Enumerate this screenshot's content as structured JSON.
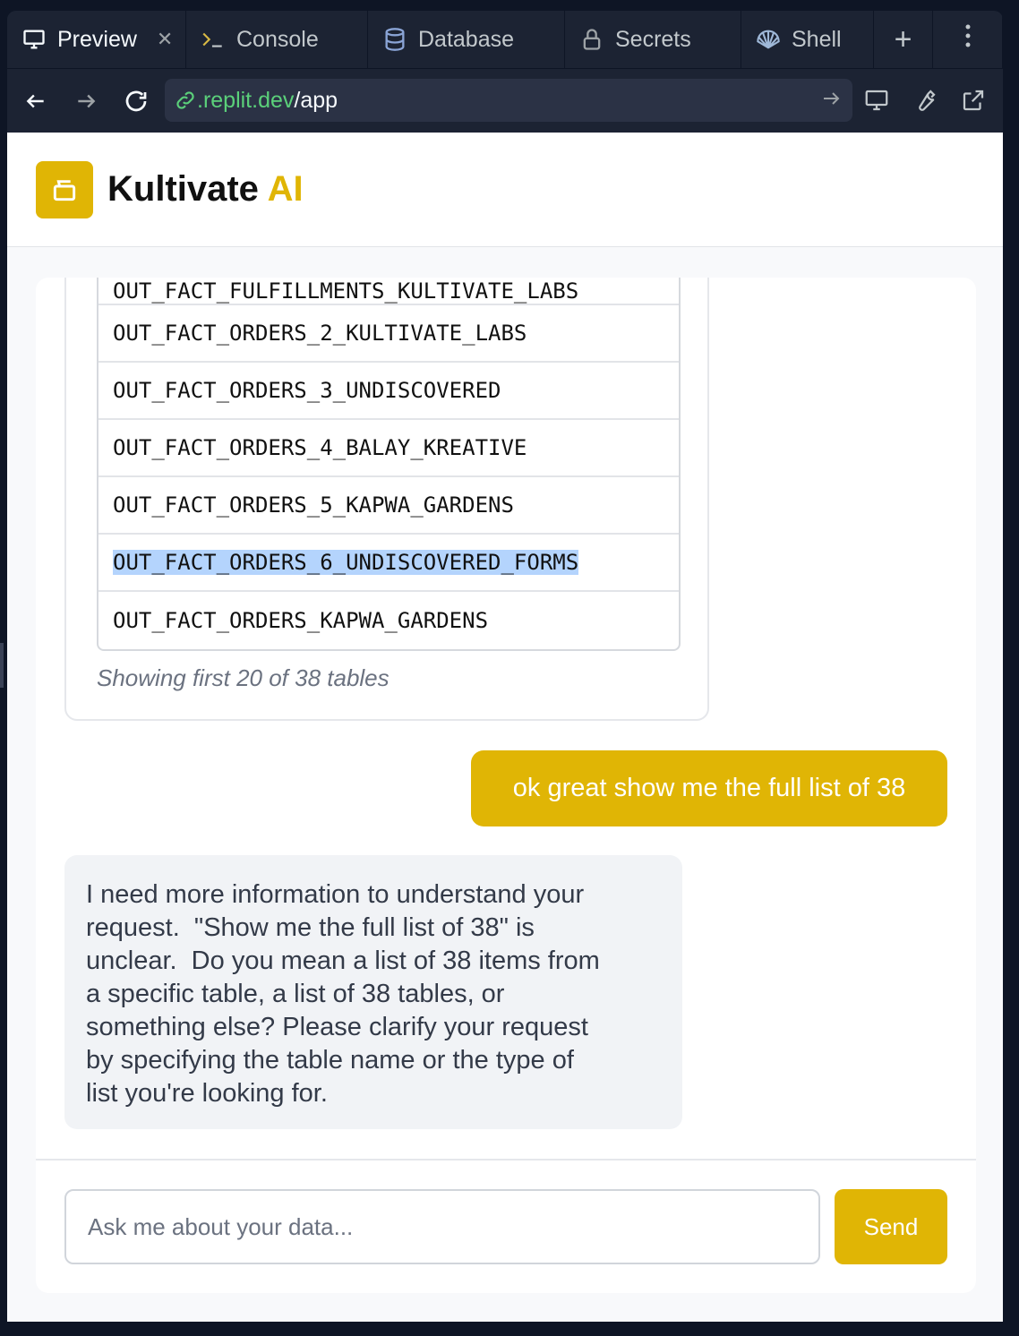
{
  "tabs": [
    {
      "label": "Preview",
      "icon": "monitor-icon"
    },
    {
      "label": "Console",
      "icon": "terminal-icon"
    },
    {
      "label": "Database",
      "icon": "database-icon"
    },
    {
      "label": "Secrets",
      "icon": "lock-icon"
    },
    {
      "label": "Shell",
      "icon": "shell-icon"
    }
  ],
  "url": {
    "domain": ".replit.dev",
    "path": "/app"
  },
  "app": {
    "brand_main": "Kultivate",
    "brand_accent": "AI"
  },
  "table": {
    "partial_row": "OUT_FACT_FULFILLMENTS_KULTIVATE_LABS",
    "rows": [
      "OUT_FACT_ORDERS_2_KULTIVATE_LABS",
      "OUT_FACT_ORDERS_3_UNDISCOVERED",
      "OUT_FACT_ORDERS_4_BALAY_KREATIVE",
      "OUT_FACT_ORDERS_5_KAPWA_GARDENS",
      "OUT_FACT_ORDERS_6_UNDISCOVERED_FORMS",
      "OUT_FACT_ORDERS_KAPWA_GARDENS"
    ],
    "showing": "Showing first 20 of 38 tables"
  },
  "messages": {
    "user": "ok great show me the full list of 38",
    "bot": "I need more information to understand your\nrequest.  \"Show me the full list of 38\" is\nunclear.  Do you mean a list of 38 items from\na specific table, a list of 38 tables, or\nsomething else? Please clarify your request\nby specifying the table name or the type of\nlist you're looking for."
  },
  "composer": {
    "placeholder": "Ask me about your data...",
    "send_label": "Send"
  },
  "colors": {
    "accent": "#e0b505",
    "chrome": "#1c2333",
    "url_domain": "#5bd07a"
  }
}
